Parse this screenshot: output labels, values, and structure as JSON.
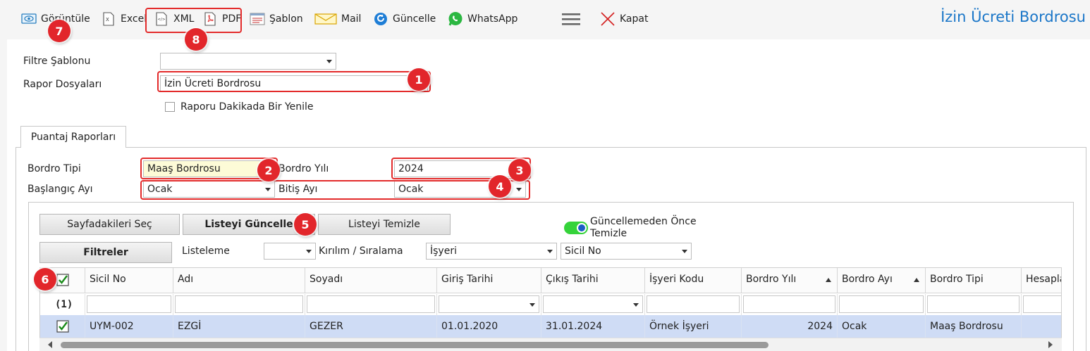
{
  "toolbar": {
    "view_label": "Görüntüle",
    "excel_label": "Excel",
    "xml_label": "XML",
    "pdf_label": "PDF",
    "template_label": "Şablon",
    "mail_label": "Mail",
    "refresh_label": "Güncelle",
    "whatsapp_label": "WhatsApp",
    "close_label": "Kapat",
    "icons": [
      "view-icon",
      "excel-icon",
      "xml-icon",
      "pdf-icon",
      "template-icon",
      "mail-icon",
      "refresh-icon",
      "whatsapp-icon",
      "menu-icon",
      "close-icon"
    ]
  },
  "report_title": "İzin Ücreti Bordrosu",
  "filter": {
    "template_label": "Filtre Şablonu",
    "template_value": "",
    "report_files_label": "Rapor Dosyaları",
    "report_files_value": "İzin Ücreti Bordrosu",
    "auto_refresh_label": "Raporu Dakikada Bir Yenile",
    "auto_refresh_checked": false
  },
  "tabs": [
    {
      "label": "Puantaj Raporları",
      "active": true
    }
  ],
  "params": {
    "payroll_type_label": "Bordro Tipi",
    "payroll_type_value": "Maaş Bordrosu",
    "payroll_year_label": "Bordro Yılı",
    "payroll_year_value": "2024",
    "start_month_label": "Başlangıç Ayı",
    "start_month_value": "Ocak",
    "end_month_label": "Bitiş Ayı",
    "end_month_value": "Ocak"
  },
  "list_actions": {
    "select_page_label": "Sayfadakileri Seç",
    "update_list_label": "Listeyi Güncelle",
    "clear_list_label": "Listeyi Temizle",
    "clear_before_update_label_1": "Güncellemeden Önce",
    "clear_before_update_label_2": "Temizle",
    "clear_before_update_on": true,
    "filters_label": "Filtreler",
    "listing_label": "Listeleme",
    "listing_value": "",
    "breakdown_label": "Kırılım / Sıralama",
    "breakdown_value_1": "İşyeri",
    "breakdown_value_2": "Sicil No"
  },
  "grid": {
    "columns": [
      {
        "label": ""
      },
      {
        "label": "Sicil No"
      },
      {
        "label": "Adı"
      },
      {
        "label": "Soyadı"
      },
      {
        "label": "Giriş Tarihi"
      },
      {
        "label": "Çıkış Tarihi"
      },
      {
        "label": "İşyeri Kodu"
      },
      {
        "label": "Bordro Yılı",
        "sort": "asc"
      },
      {
        "label": "Bordro Ayı",
        "sort": "asc"
      },
      {
        "label": "Bordro Tipi"
      },
      {
        "label": "Hesapla"
      }
    ],
    "selected_count": "(1)",
    "rows": [
      {
        "checked": true,
        "sicil_no": "UYM-002",
        "adi": "EZGİ",
        "soyadi": "GEZER",
        "giris": "01.01.2020",
        "cikis": "31.01.2024",
        "isyeri_kodu": "Örnek İşyeri",
        "bordro_yili": "2024",
        "bordro_ayi": "Ocak",
        "bordro_tipi": "Maaş Bordrosu"
      }
    ]
  },
  "badges": [
    "1",
    "2",
    "3",
    "4",
    "5",
    "6",
    "7",
    "8"
  ],
  "colors": {
    "accent": "#1a76c8",
    "badge": "#e2262b",
    "selected_row": "#cfdcf5",
    "toggle_on": "#35d33a"
  }
}
